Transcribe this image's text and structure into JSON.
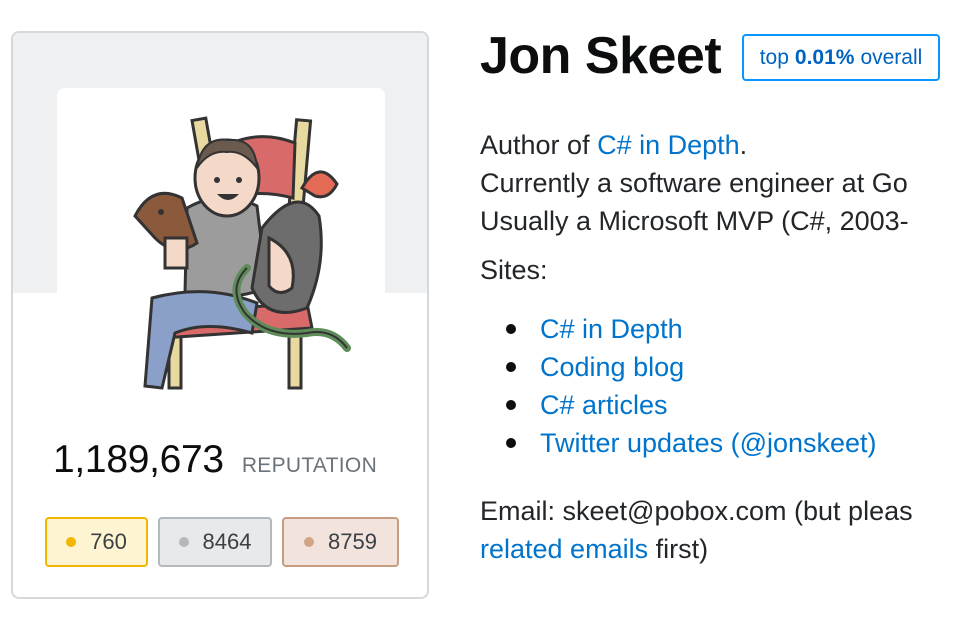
{
  "profile": {
    "name": "Jon Skeet",
    "rank_prefix": "top",
    "rank_value": "0.01%",
    "rank_suffix": "overall",
    "reputation": "1,189,673",
    "reputation_label": "REPUTATION",
    "badges": {
      "gold": "760",
      "silver": "8464",
      "bronze": "8759"
    },
    "colors": {
      "gold": "#f1b600",
      "silver": "#b3b8bc",
      "bronze": "#c59c82",
      "link": "#0074cc"
    }
  },
  "about": {
    "line1_prefix": "Author of ",
    "line1_link": "C# in Depth",
    "line1_suffix": ".",
    "line2": "Currently a software engineer at Go",
    "line3": "Usually a Microsoft MVP (C#, 2003-",
    "sites_label": "Sites:",
    "sites": [
      "C# in Depth",
      "Coding blog",
      "C# articles",
      "Twitter updates (@jonskeet)"
    ],
    "email_prefix": "Email: skeet@pobox.com (but pleas",
    "email_link": "related emails",
    "email_suffix": " first)"
  },
  "avatar_description": "cartoon-avatar-icon"
}
